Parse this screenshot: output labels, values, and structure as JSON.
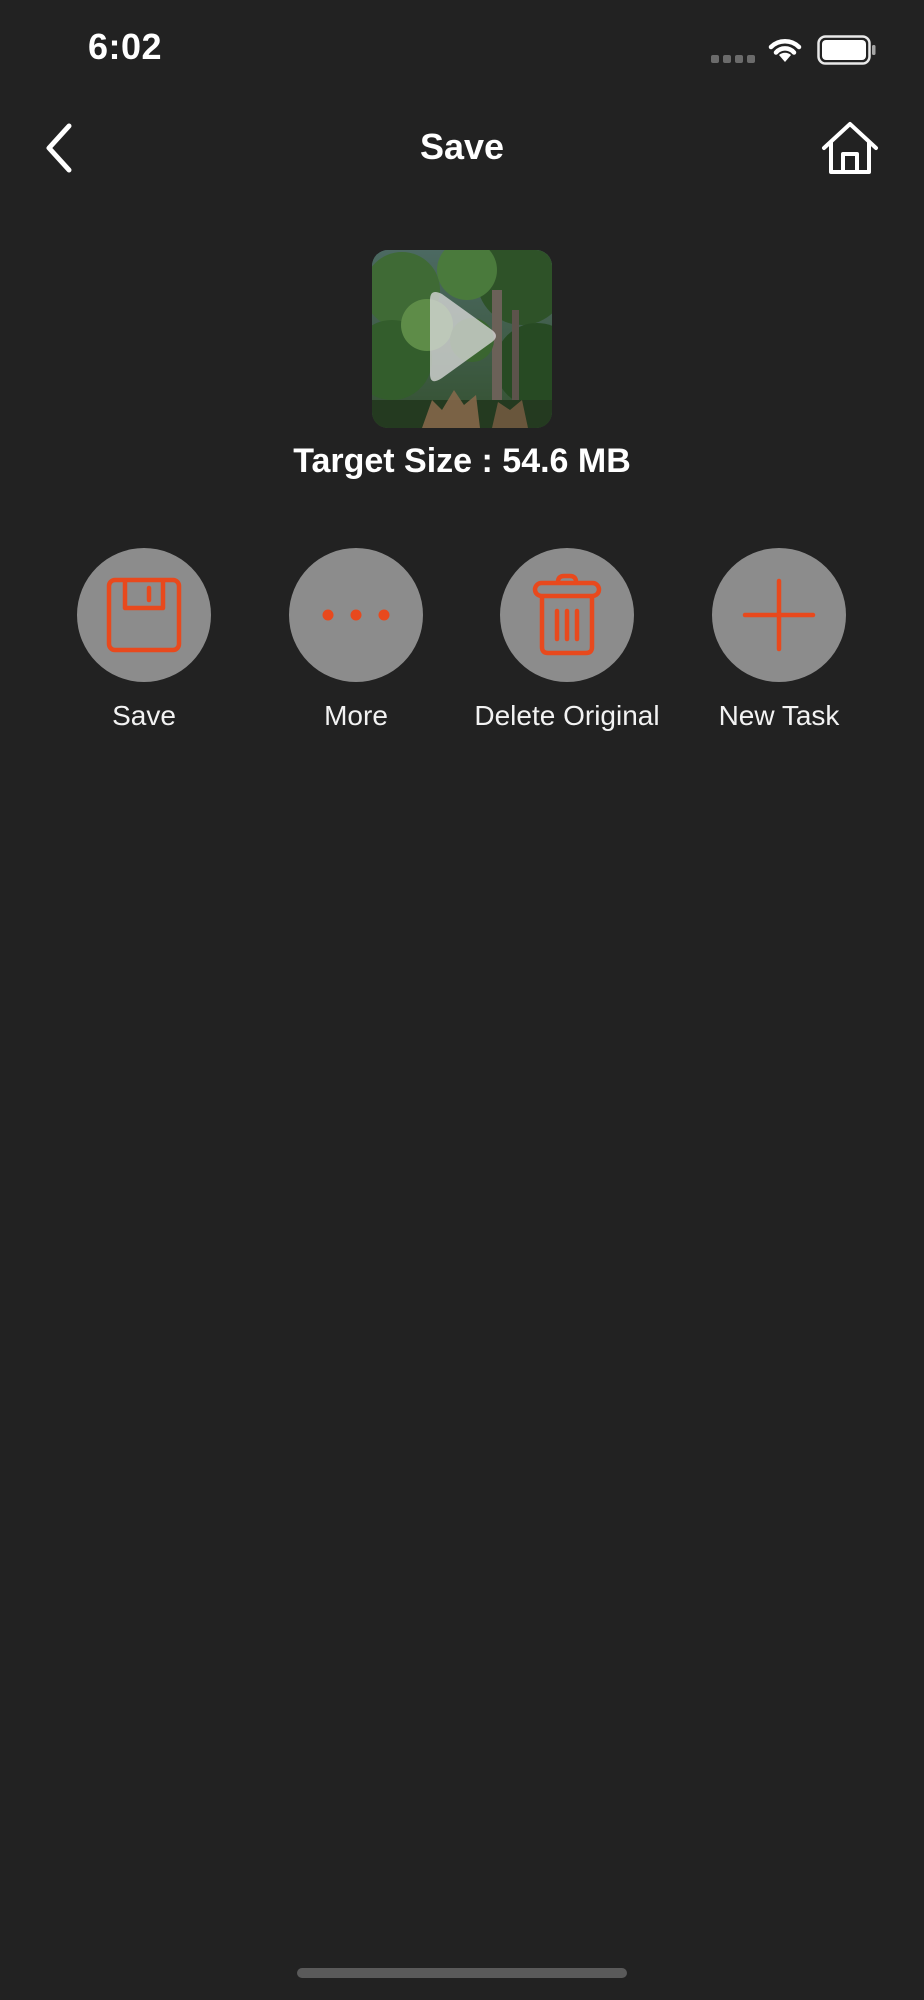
{
  "status_bar": {
    "time": "6:02"
  },
  "nav": {
    "title": "Save",
    "back_icon": "chevron-left-icon",
    "home_icon": "house-icon"
  },
  "media": {
    "thumbnail": "video-thumbnail",
    "play_icon": "play-icon",
    "target_size": "Target Size : 54.6 MB"
  },
  "actions": [
    {
      "label": "Save",
      "icon": "floppy-disk-icon"
    },
    {
      "label": "More",
      "icon": "ellipsis-icon"
    },
    {
      "label": "Delete Original",
      "icon": "trash-icon"
    },
    {
      "label": "New Task",
      "icon": "plus-icon"
    }
  ],
  "colors": {
    "background": "#222222",
    "accent": "#e8491d",
    "action_circle": "#8c8c8c",
    "text": "#ffffff"
  }
}
